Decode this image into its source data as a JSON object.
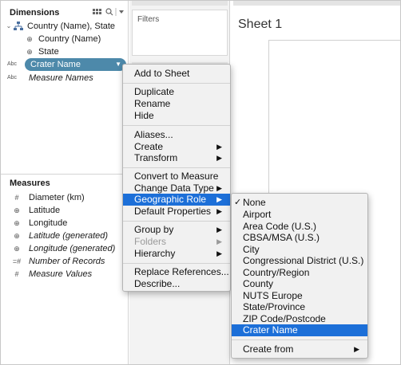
{
  "dimensions": {
    "title": "Dimensions",
    "header_icons": [
      "grid-view-icon",
      "search-icon",
      "dropdown-icon"
    ],
    "items": [
      {
        "icon": "hierarchy-icon",
        "label": "Country (Name), State",
        "italic": false
      },
      {
        "icon": "globe-icon",
        "label": "Country (Name)",
        "italic": false
      },
      {
        "icon": "globe-icon",
        "label": "State",
        "italic": false
      },
      {
        "icon": "abc-icon",
        "label": "Crater Name",
        "italic": false,
        "selected": true
      },
      {
        "icon": "abc-icon",
        "label": "Measure Names",
        "italic": true
      }
    ],
    "abc_text": "Abc"
  },
  "measures": {
    "title": "Measures",
    "items": [
      {
        "icon": "hash-icon",
        "label": "Diameter (km)",
        "italic": false
      },
      {
        "icon": "globe-icon",
        "label": "Latitude",
        "italic": false
      },
      {
        "icon": "globe-icon",
        "label": "Longitude",
        "italic": false
      },
      {
        "icon": "globe-icon",
        "label": "Latitude (generated)",
        "italic": true
      },
      {
        "icon": "globe-icon",
        "label": "Longitude (generated)",
        "italic": true
      },
      {
        "icon": "hash-equals-icon",
        "label": "Number of Records",
        "italic": true
      },
      {
        "icon": "hash-icon",
        "label": "Measure Values",
        "italic": true
      }
    ]
  },
  "cards": {
    "filters_label": "Filters"
  },
  "sheet": {
    "title": "Sheet 1"
  },
  "context_menu": {
    "items": [
      "Add to Sheet",
      "Duplicate",
      "Rename",
      "Hide",
      "Aliases...",
      "Create",
      "Transform",
      "Convert to Measure",
      "Change Data Type",
      "Geographic Role",
      "Default Properties",
      "Group by",
      "Folders",
      "Hierarchy",
      "Replace References...",
      "Describe..."
    ],
    "highlighted": "Geographic Role"
  },
  "geo_menu": {
    "items": [
      "None",
      "Airport",
      "Area Code (U.S.)",
      "CBSA/MSA (U.S.)",
      "City",
      "Congressional District (U.S.)",
      "Country/Region",
      "County",
      "NUTS Europe",
      "State/Province",
      "ZIP Code/Postcode",
      "Crater Name",
      "Create from"
    ],
    "checked": "None",
    "highlighted": "Crater Name"
  },
  "colors": {
    "pill": "#4d89aa",
    "highlight": "#1c6fd8",
    "geo_icon": "#3a8c6a"
  }
}
